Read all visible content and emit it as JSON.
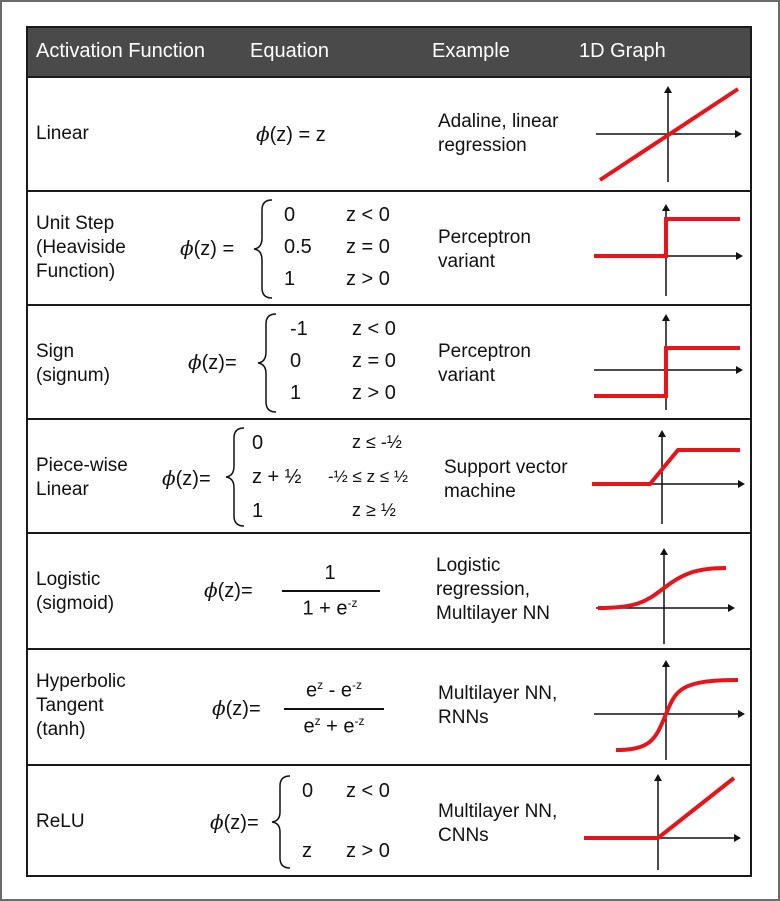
{
  "header": {
    "col_function": "Activation Function",
    "col_equation": "Equation",
    "col_example": "Example",
    "col_graph": "1D Graph"
  },
  "phi_symbol": "ϕ",
  "rows": [
    {
      "name_lines": [
        "Linear"
      ],
      "equation_rhs": "(z) = z",
      "example_lines": [
        "Adaline, linear",
        "regression"
      ]
    },
    {
      "name_lines": [
        "Unit Step",
        "(Heaviside",
        "Function)"
      ],
      "equation_prefix": "(z) =",
      "cases": [
        {
          "value": "0",
          "cond": "z < 0"
        },
        {
          "value": "0.5",
          "cond": "z = 0"
        },
        {
          "value": "1",
          "cond": "z > 0"
        }
      ],
      "example_lines": [
        "Perceptron",
        "variant"
      ]
    },
    {
      "name_lines": [
        "Sign",
        "(signum)"
      ],
      "equation_prefix": "(z)=",
      "cases": [
        {
          "value": "-1",
          "cond": "z < 0"
        },
        {
          "value": "0",
          "cond": "z = 0"
        },
        {
          "value": "1",
          "cond": "z > 0"
        }
      ],
      "example_lines": [
        "Perceptron",
        "variant"
      ]
    },
    {
      "name_lines": [
        "Piece-wise",
        "Linear"
      ],
      "equation_prefix": "(z)=",
      "cases": [
        {
          "value": "0",
          "cond": "z ≤ -½"
        },
        {
          "value": "z + ½",
          "cond": "-½ ≤ z ≤ ½"
        },
        {
          "value": "1",
          "cond": "z ≥ ½"
        }
      ],
      "example_lines": [
        "Support vector",
        "machine"
      ]
    },
    {
      "name_lines": [
        "Logistic",
        "(sigmoid)"
      ],
      "equation_prefix": "(z)=",
      "numerator": "1",
      "denominator": "1 + e",
      "denominator_exp": "-z",
      "example_lines": [
        "Logistic",
        "regression,",
        "Multilayer NN"
      ]
    },
    {
      "name_lines": [
        "Hyperbolic",
        "Tangent",
        "(tanh)"
      ],
      "equation_prefix": "(z)=",
      "numerator_a": "e",
      "numerator_a_exp": "z",
      "numerator_op": " - e",
      "numerator_b_exp": "-z",
      "denominator_a": "e",
      "denominator_a_exp": "z",
      "denominator_op": " + e",
      "denominator_b_exp": "-z",
      "example_lines": [
        "Multilayer NN,",
        "RNNs"
      ]
    },
    {
      "name_lines": [
        "ReLU"
      ],
      "equation_prefix": "(z)=",
      "cases": [
        {
          "value": "0",
          "cond": "z < 0"
        },
        {
          "value": "z",
          "cond": "z > 0"
        }
      ],
      "example_lines": [
        "Multilayer NN,",
        "CNNs"
      ]
    }
  ],
  "colors": {
    "header_bg": "#4a4a4a",
    "curve": "#e8141b",
    "axis": "#111111"
  }
}
